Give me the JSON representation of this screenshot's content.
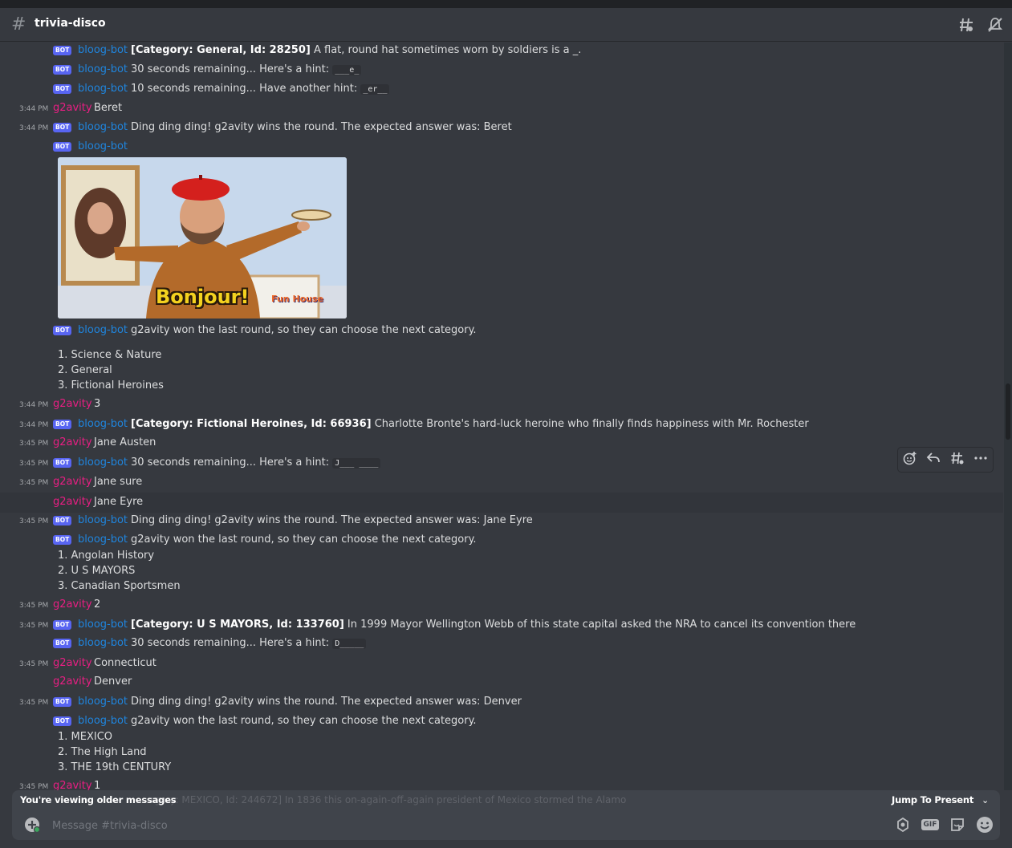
{
  "channel": {
    "name": "trivia-disco"
  },
  "labels": {
    "bot_tag": "BOT",
    "bot_name": "bloog-bot",
    "user_name": "g2avity"
  },
  "messages": {
    "m0": {
      "cat": "[Category: General, Id: 28250]",
      "text": "A flat, round hat sometimes worn by soldiers is a _."
    },
    "m1": {
      "text": "30 seconds remaining... Here's a hint:",
      "code": "___e_"
    },
    "m2": {
      "text": "10 seconds remaining... Have another hint:",
      "code": "_er__"
    },
    "m3": {
      "time": "3:44 PM",
      "text": "Beret"
    },
    "m4": {
      "time": "3:44 PM",
      "text": "Ding ding ding! g2avity wins the round. The expected answer was: Beret"
    },
    "gif": {
      "caption": "Bonjour!",
      "watermark": "Fun House"
    },
    "m6": {
      "text": "g2avity won the last round, so they can choose the next category.",
      "options": [
        "1. Science & Nature",
        "2. General",
        "3. Fictional Heroines"
      ]
    },
    "m7": {
      "time": "3:44 PM",
      "text": "3"
    },
    "m8": {
      "time": "3:44 PM",
      "cat": "[Category: Fictional Heroines, Id: 66936]",
      "text": "Charlotte Bronte's hard-luck heroine who finally finds happiness with Mr. Rochester"
    },
    "m9": {
      "time": "3:45 PM",
      "text": "Jane Austen"
    },
    "m10": {
      "time": "3:45 PM",
      "text": "30 seconds remaining... Here's a hint:",
      "code": "J___ ____"
    },
    "m11": {
      "time": "3:45 PM",
      "text": "Jane sure"
    },
    "m12": {
      "text": "Jane Eyre"
    },
    "m13": {
      "time": "3:45 PM",
      "text": "Ding ding ding! g2avity wins the round. The expected answer was: Jane Eyre"
    },
    "m14": {
      "text": "g2avity won the last round, so they can choose the next category.",
      "options": [
        "1. Angolan History",
        "2. U S MAYORS",
        "3. Canadian Sportsmen"
      ]
    },
    "m15": {
      "time": "3:45 PM",
      "text": "2"
    },
    "m16": {
      "time": "3:45 PM",
      "cat": "[Category: U S MAYORS, Id: 133760]",
      "text": "In 1999 Mayor Wellington Webb of this state capital asked the NRA to cancel its convention there"
    },
    "m17": {
      "text": "30 seconds remaining... Here's a hint:",
      "code": "D_____"
    },
    "m18": {
      "time": "3:45 PM",
      "text": "Connecticut"
    },
    "m19": {
      "text": "Denver"
    },
    "m20": {
      "time": "3:45 PM",
      "text": "Ding ding ding! g2avity wins the round. The expected answer was: Denver"
    },
    "m21": {
      "text": "g2avity won the last round, so they can choose the next category.",
      "options": [
        "1. MEXICO",
        "2. The High Land",
        "3. THE 19th CENTURY"
      ]
    },
    "m22": {
      "time": "3:45 PM",
      "text": "1"
    }
  },
  "older_bar": {
    "label": "You're viewing older messages",
    "ghost": "egory: MEXICO, Id: 244672] In 1836 this on-again-off-again president of Mexico stormed the Alamo",
    "jump": "Jump To Present"
  },
  "composer": {
    "placeholder": "Message #trivia-disco",
    "gif_label": "GIF"
  },
  "icons": [
    "hash-icon",
    "threads-icon",
    "mute-icon",
    "add-reaction-icon",
    "reply-icon",
    "create-thread-icon",
    "more-icon",
    "chevron-down-icon",
    "add-attachment-icon",
    "nitro-icon",
    "gif-icon",
    "sticker-icon",
    "emoji-icon"
  ],
  "colors": {
    "bot_name": "#1f85de",
    "user_name": "#e91e83",
    "bot_tag": "#5865f2",
    "background": "#36393f"
  }
}
